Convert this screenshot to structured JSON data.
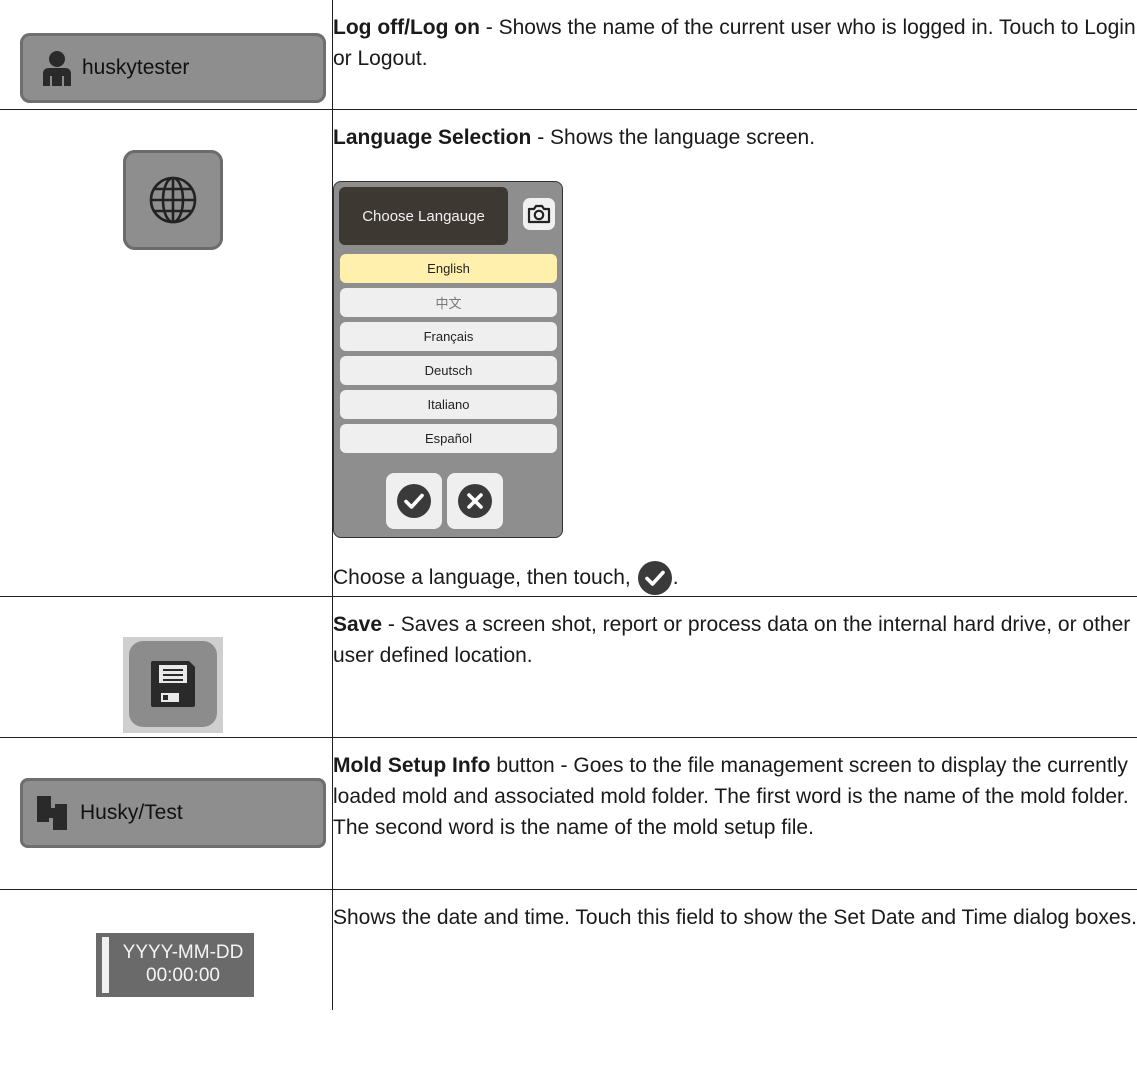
{
  "rows": {
    "logon": {
      "button_label": "huskytester",
      "title": "Log off/Log on",
      "text": " - Shows the name of the current user who is logged in. Touch to Login or Logout."
    },
    "language": {
      "title": "Language Selection",
      "text": " - Shows the language screen.",
      "dialog": {
        "header": "Choose Langauge",
        "languages": [
          "English",
          "中文",
          "Français",
          "Deutsch",
          "Italiano",
          "Español"
        ],
        "selected": "English"
      },
      "choose_text": "Choose a language, then touch,",
      "choose_end": "."
    },
    "save": {
      "title": "Save",
      "text": " - Saves a screen shot, report or process data on the internal hard drive, or other user defined location."
    },
    "mold": {
      "button_label": "Husky/Test",
      "title": "Mold Setup Info",
      "text": " button - Goes to the file management screen to display the currently loaded mold and associated mold folder. The first word is the name of the mold folder. The second word is the name of the mold setup file."
    },
    "datetime": {
      "date_label": "YYYY-MM-DD",
      "time_label": "00:00:00",
      "text": "Shows the date and time. Touch this field to show the Set Date and Time dialog boxes."
    }
  },
  "icons": {
    "user": "user-icon",
    "globe": "globe-icon",
    "camera": "camera-icon",
    "check": "check-icon",
    "cancel": "cancel-icon",
    "save": "floppy-disk-icon",
    "mold": "mold-icon"
  },
  "colors": {
    "button_gray": "#8e8e8e",
    "dialog_header": "#3e3833",
    "selected_language": "#fff1ad",
    "datetime_bg": "#6a6a6a",
    "check_dark": "#3a3a3a"
  }
}
